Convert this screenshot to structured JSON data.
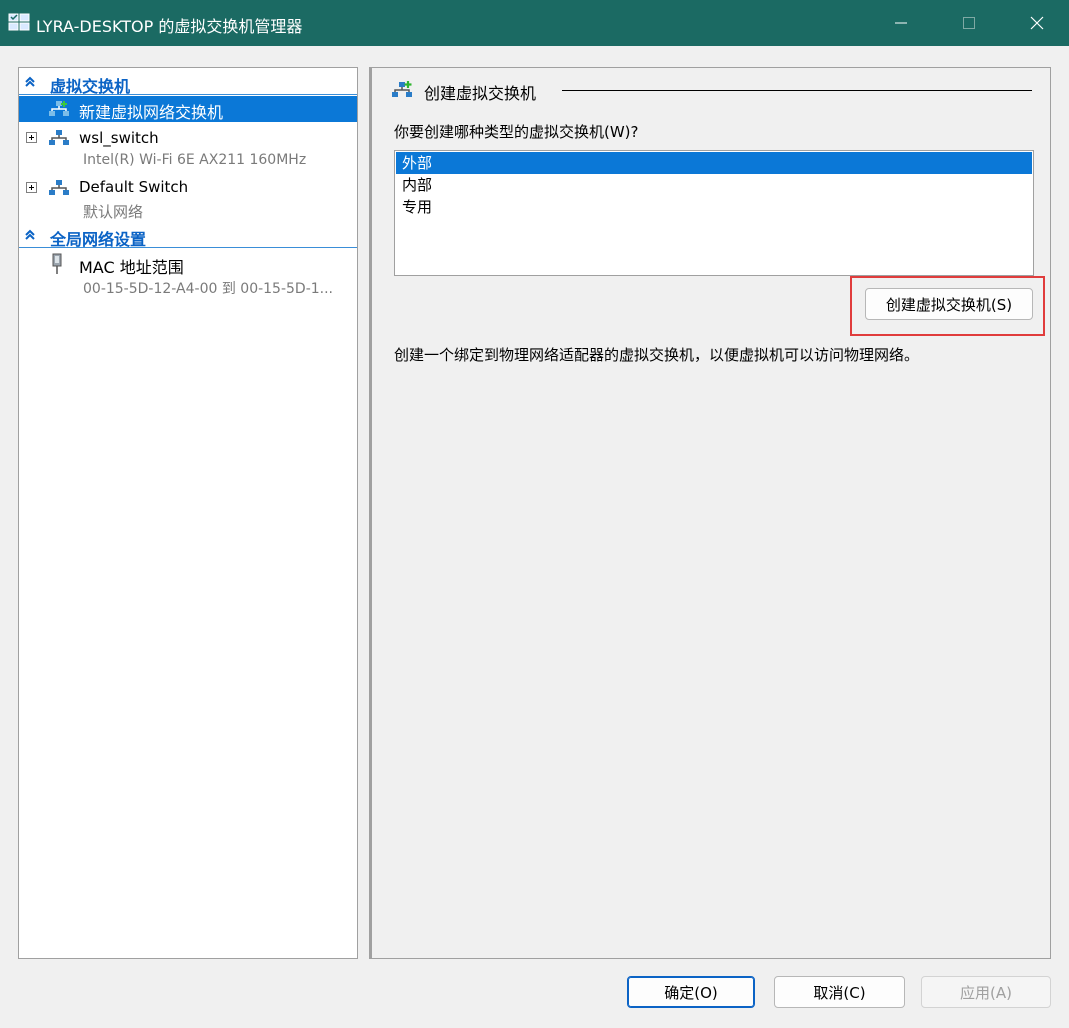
{
  "window": {
    "title": "LYRA-DESKTOP 的虚拟交换机管理器"
  },
  "sidebar": {
    "section_switches": "虚拟交换机",
    "new_switch": "新建虚拟网络交换机",
    "switches": [
      {
        "name": "wsl_switch",
        "detail": "Intel(R) Wi-Fi 6E AX211 160MHz"
      },
      {
        "name": "Default Switch",
        "detail": "默认网络"
      }
    ],
    "section_global": "全局网络设置",
    "mac_range": {
      "name": "MAC 地址范围",
      "detail": "00-15-5D-12-A4-00 到 00-15-5D-1..."
    }
  },
  "main": {
    "header": "创建虚拟交换机",
    "question": "你要创建哪种类型的虚拟交换机(W)?",
    "switch_types": [
      "外部",
      "内部",
      "专用"
    ],
    "selected_type": "外部",
    "create_button": "创建虚拟交换机(S)",
    "description": "创建一个绑定到物理网络适配器的虚拟交换机，以便虚拟机可以访问物理网络。"
  },
  "footer": {
    "ok": "确定(O)",
    "cancel": "取消(C)",
    "apply": "应用(A)"
  },
  "colors": {
    "titlebar": "#1b6a63",
    "selection": "#0b78d7",
    "section_text": "#0b63c5",
    "highlight_box": "#e03c3c"
  }
}
